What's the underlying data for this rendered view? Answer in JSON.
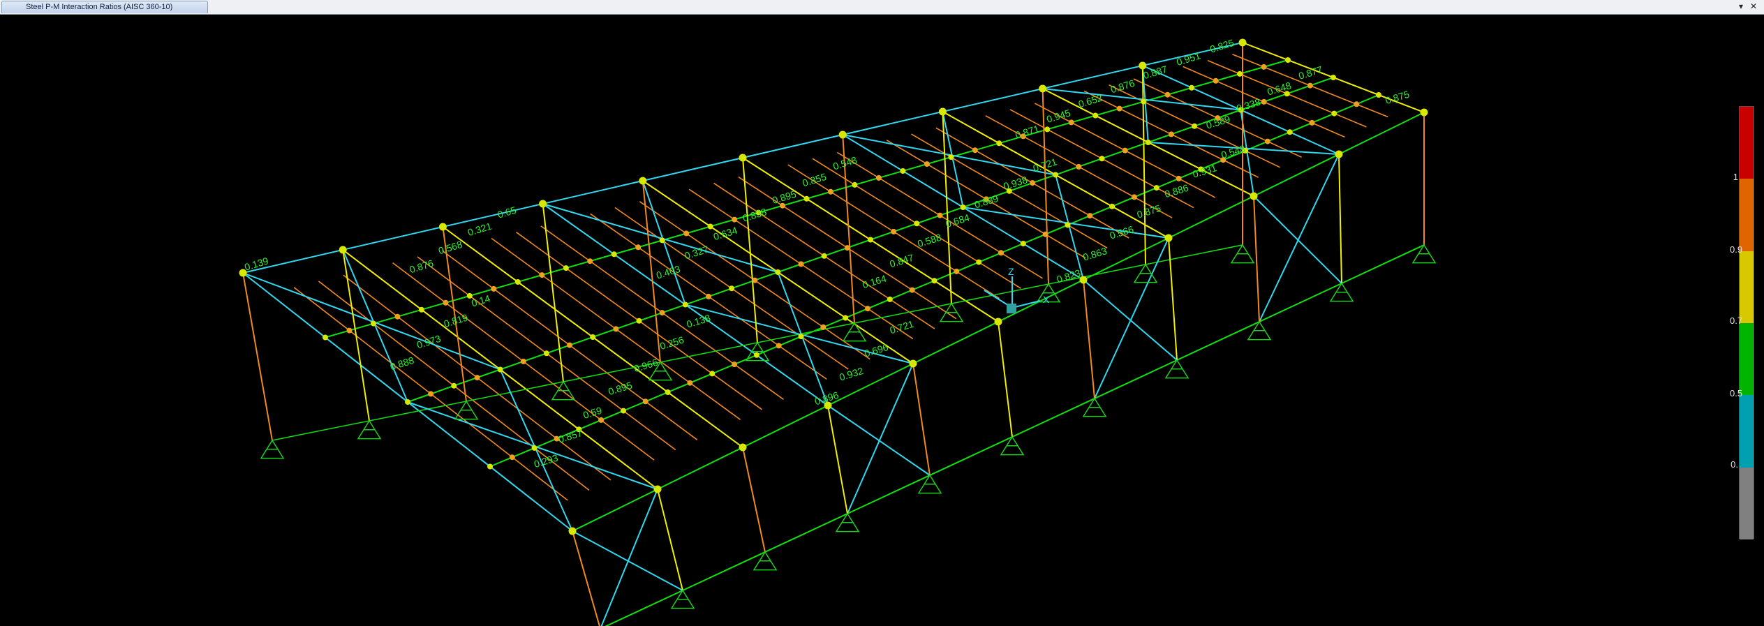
{
  "window": {
    "tab_title": "Steel P-M Interaction Ratios  (AISC 360-10)",
    "dropdown_glyph": "▾",
    "close_glyph": "✕"
  },
  "legend": {
    "colors": [
      "#c80000",
      "#e06400",
      "#d8c800",
      "#00b400",
      "#00a0b0",
      "#808080"
    ],
    "labels": [
      "1",
      "0.9",
      "0.7",
      "0.5",
      "0."
    ]
  },
  "member_colors": {
    "brace": "#30d8f0",
    "column": "#f0f000",
    "beam_low": "#10e010",
    "joist": "#f08a20",
    "node": "#d8e800"
  },
  "ratio_labels": [
    "0.139",
    "0.14",
    "0.138",
    "0.721",
    "0.548",
    "0.721",
    "0.548",
    "0.825",
    "0.819",
    "0.256",
    "0.696",
    "0.855",
    "0.938",
    "0.931",
    "0.951",
    "0.973",
    "0.966",
    "0.932",
    "0.895",
    "0.889",
    "0.886",
    "0.887",
    "0.888",
    "0.895",
    "0.896",
    "0.838",
    "0.684",
    "0.875",
    "0.876",
    "0.877",
    "0.59",
    "0.65",
    "0.634",
    "0.588",
    "0.566",
    "0.652",
    "0.648",
    "0.857",
    "0.321",
    "0.327",
    "0.847",
    "0.863",
    "0.945",
    "0.338",
    "0.293",
    "0.568",
    "0.403",
    "0.164",
    "0.823",
    "0.871",
    "0.589",
    "0.875",
    "0.876"
  ]
}
